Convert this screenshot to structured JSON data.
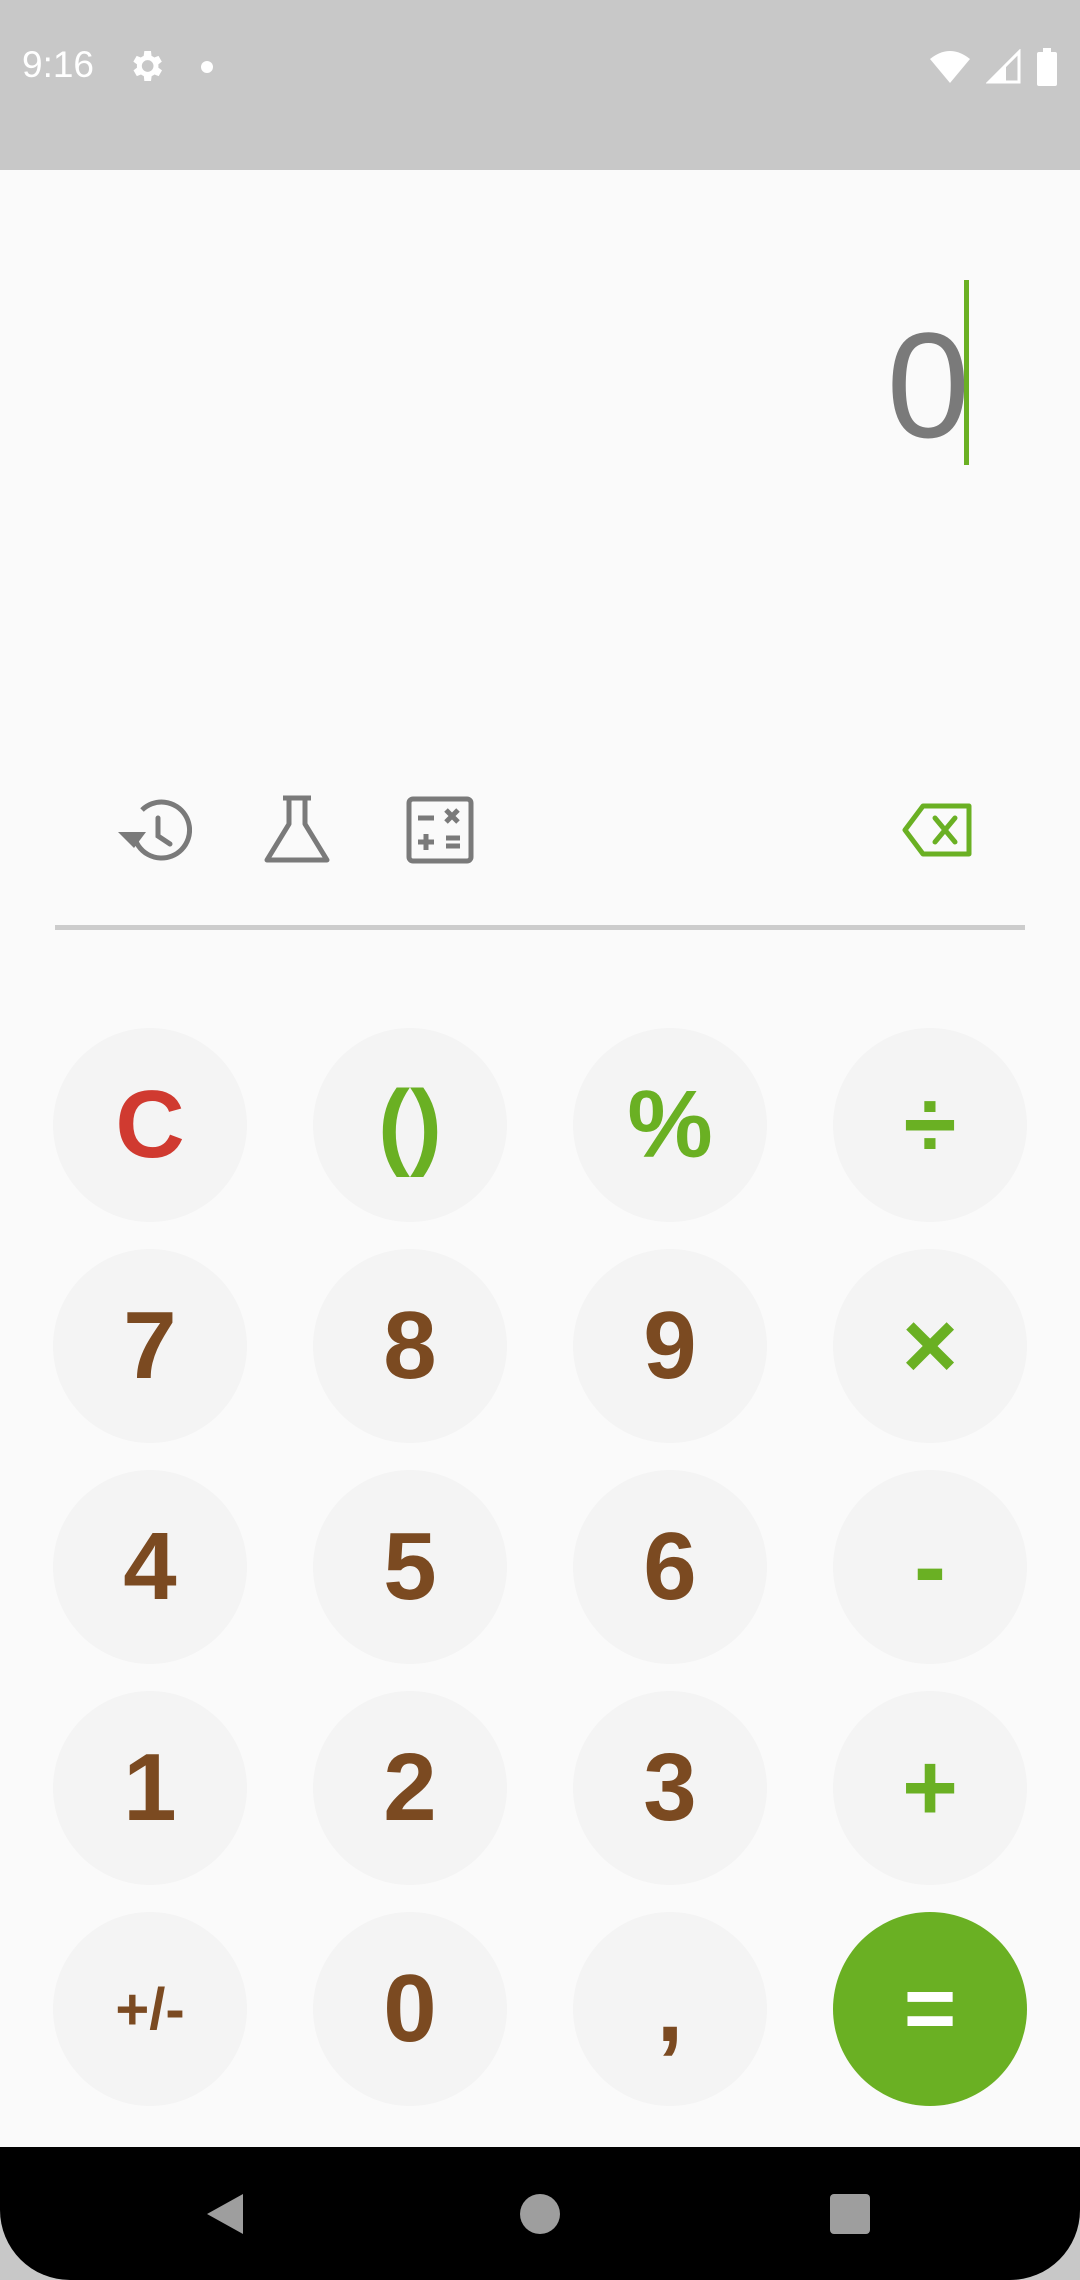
{
  "status_bar": {
    "time": "9:16",
    "icons": [
      "settings-icon",
      "notification-dot-icon",
      "wifi-icon",
      "signal-icon",
      "battery-icon"
    ]
  },
  "display": {
    "value": "0",
    "cursor_color": "#6ab023"
  },
  "toolbar": {
    "icons": [
      "history-icon",
      "scientific-flask-icon",
      "unit-converter-icon",
      "backspace-icon"
    ]
  },
  "keypad": {
    "rows": [
      [
        {
          "label": "C",
          "role": "clear"
        },
        {
          "label": "()",
          "role": "op"
        },
        {
          "label": "%",
          "role": "op"
        },
        {
          "label": "÷",
          "role": "op"
        }
      ],
      [
        {
          "label": "7",
          "role": "digit"
        },
        {
          "label": "8",
          "role": "digit"
        },
        {
          "label": "9",
          "role": "digit"
        },
        {
          "label": "×",
          "role": "op"
        }
      ],
      [
        {
          "label": "4",
          "role": "digit"
        },
        {
          "label": "5",
          "role": "digit"
        },
        {
          "label": "6",
          "role": "digit"
        },
        {
          "label": "-",
          "role": "op"
        }
      ],
      [
        {
          "label": "1",
          "role": "digit"
        },
        {
          "label": "2",
          "role": "digit"
        },
        {
          "label": "3",
          "role": "digit"
        },
        {
          "label": "+",
          "role": "op"
        }
      ],
      [
        {
          "label": "+/-",
          "role": "digit"
        },
        {
          "label": "0",
          "role": "digit"
        },
        {
          "label": ",",
          "role": "digit"
        },
        {
          "label": "=",
          "role": "equals"
        }
      ]
    ]
  },
  "colors": {
    "accent": "#6ab023",
    "digit": "#7b4a21",
    "clear": "#d03a30",
    "icon_gray": "#7a7a7a"
  },
  "nav_bar": {
    "icons": [
      "back-icon",
      "home-icon",
      "recents-icon"
    ]
  }
}
